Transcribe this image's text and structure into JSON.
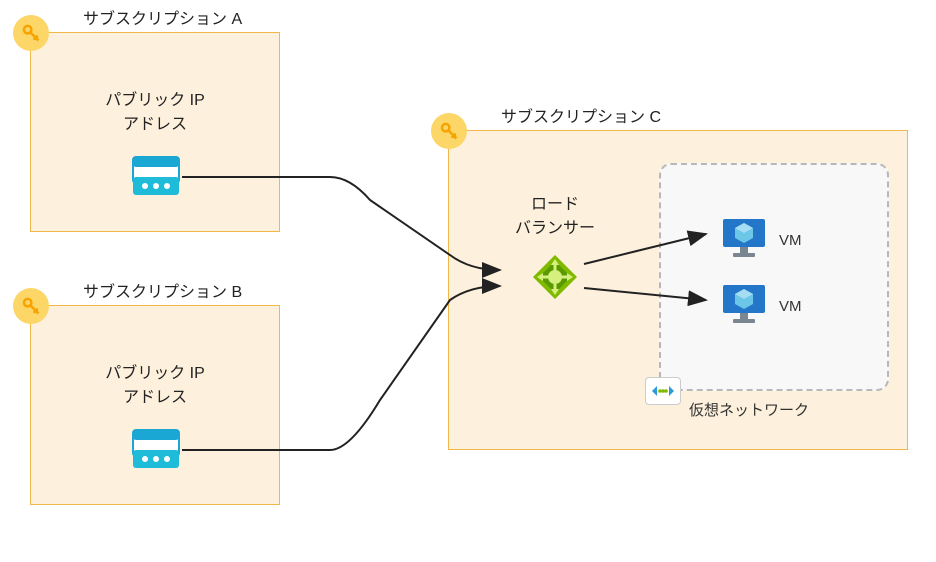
{
  "diagram": {
    "subscription_a": {
      "title": "サブスクリプション A",
      "ip_label_line1": "パブリック IP",
      "ip_label_line2": "アドレス"
    },
    "subscription_b": {
      "title": "サブスクリプション B",
      "ip_label_line1": "パブリック IP",
      "ip_label_line2": "アドレス"
    },
    "subscription_c": {
      "title": "サブスクリプション C",
      "lb_label_line1": "ロード",
      "lb_label_line2": "バランサー",
      "vm1_label": "VM",
      "vm2_label": "VM",
      "vnet_label": "仮想ネットワーク"
    }
  }
}
